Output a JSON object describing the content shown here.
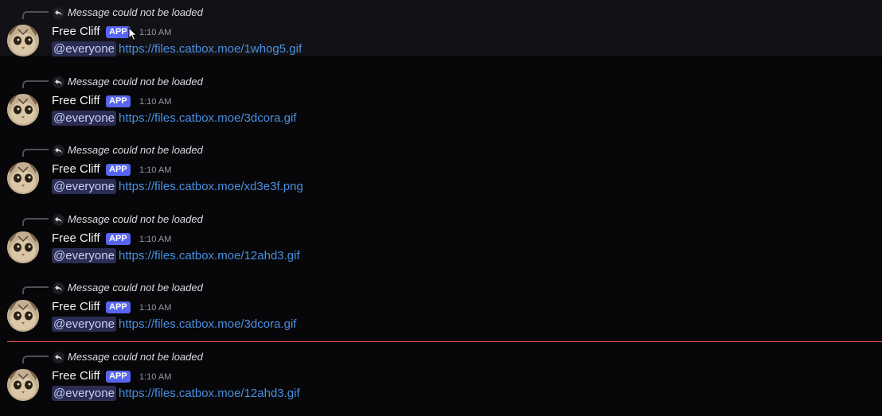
{
  "channel": {
    "reply_unavailable_text": "Message could not be loaded",
    "colors": {
      "background": "#070709",
      "hover_background": "#121216",
      "app_badge": "#5865f2",
      "link": "#4a8fe0",
      "mention_bg": "#2b2d52",
      "new_messages_divider": "#e44b4b"
    },
    "messages": [
      {
        "reply_text": "Message could not be loaded",
        "author": "Free Cliff",
        "badge": "APP",
        "time": "1:10 AM",
        "mention": "@everyone",
        "link": "https://files.catbox.moe/1whog5.gif",
        "hovered": true
      },
      {
        "reply_text": "Message could not be loaded",
        "author": "Free Cliff",
        "badge": "APP",
        "time": "1:10 AM",
        "mention": "@everyone",
        "link": "https://files.catbox.moe/3dcora.gif"
      },
      {
        "reply_text": "Message could not be loaded",
        "author": "Free Cliff",
        "badge": "APP",
        "time": "1:10 AM",
        "mention": "@everyone",
        "link": "https://files.catbox.moe/xd3e3f.png"
      },
      {
        "reply_text": "Message could not be loaded",
        "author": "Free Cliff",
        "badge": "APP",
        "time": "1:10 AM",
        "mention": "@everyone",
        "link": "https://files.catbox.moe/12ahd3.gif"
      },
      {
        "reply_text": "Message could not be loaded",
        "author": "Free Cliff",
        "badge": "APP",
        "time": "1:10 AM",
        "mention": "@everyone",
        "link": "https://files.catbox.moe/3dcora.gif"
      },
      {
        "reply_text": "Message could not be loaded",
        "author": "Free Cliff",
        "badge": "APP",
        "time": "1:10 AM",
        "mention": "@everyone",
        "link": "https://files.catbox.moe/12ahd3.gif"
      }
    ]
  }
}
